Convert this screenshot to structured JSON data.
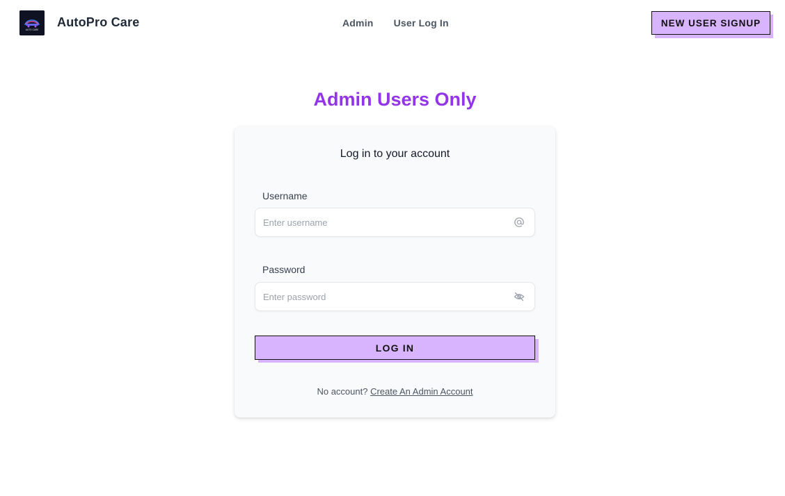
{
  "header": {
    "brand": "AutoPro Care",
    "logo_text": "AUTO CARE",
    "nav": [
      {
        "label": "Admin"
      },
      {
        "label": "User Log In"
      }
    ],
    "signup_label": "NEW USER SIGNUP"
  },
  "main": {
    "page_title": "Admin Users Only",
    "card_title": "Log in to your account",
    "username": {
      "label": "Username",
      "placeholder": "Enter username",
      "value": "",
      "icon": "at-icon"
    },
    "password": {
      "label": "Password",
      "placeholder": "Enter password",
      "value": "",
      "icon": "eye-off-icon"
    },
    "login_label": "LOG IN",
    "no_account_text": "No account?",
    "create_link": "Create An Admin Account"
  },
  "colors": {
    "accent_purple": "#9333ea",
    "button_purple": "#d8b4fe",
    "card_bg": "#f9fafb"
  }
}
